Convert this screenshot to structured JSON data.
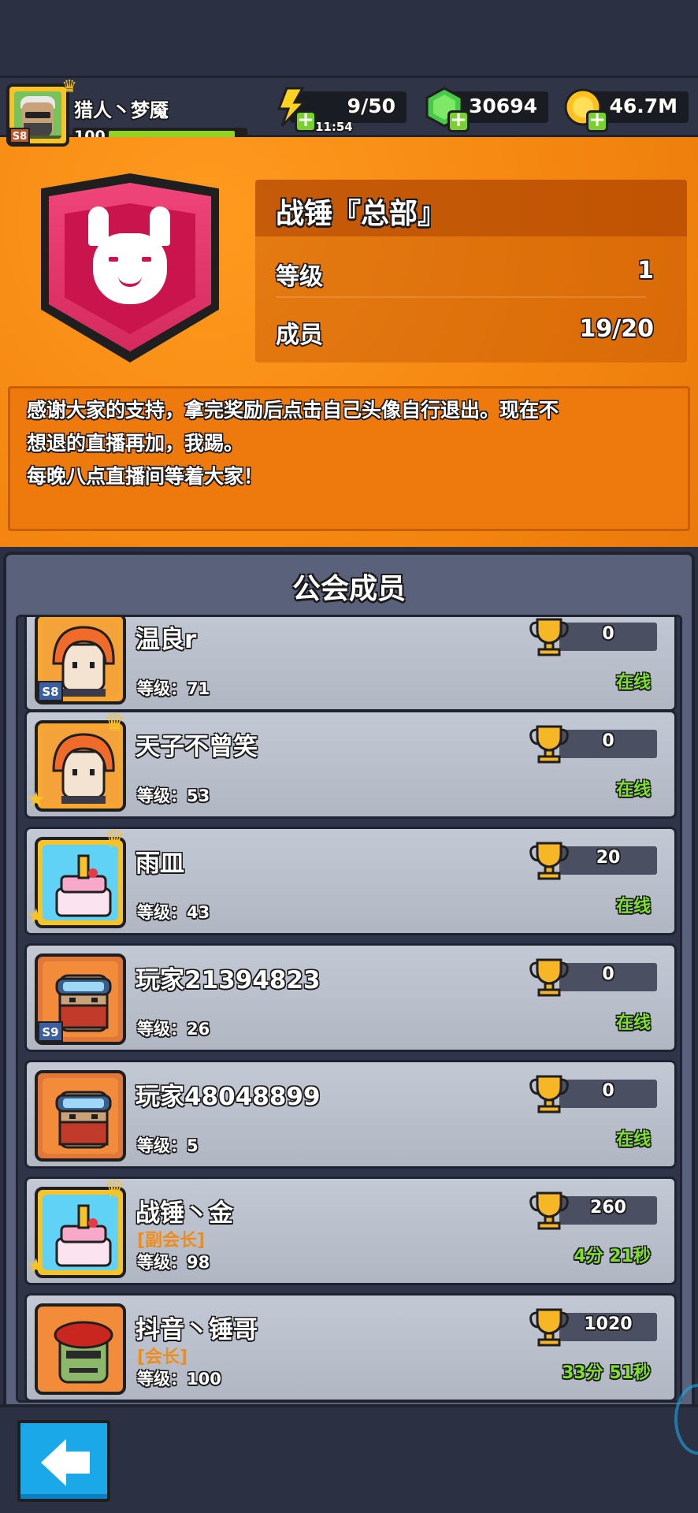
{
  "player": {
    "name": "猎人丶梦魇",
    "level": "100",
    "season": "S8",
    "level_fill": 0.95
  },
  "resources": {
    "energy": "9/50",
    "energy_timer": "11:54",
    "gems": "30694",
    "coins": "46.7M"
  },
  "guild": {
    "name": "战锤『总部』",
    "level_label": "等级",
    "level_value": "1",
    "members_label": "成员",
    "members_value": "19/20",
    "notice": "感谢大家的支持，拿完奖励后点击自己头像自行退出。现在不\n想退的直播再加，我踢。\n每晚八点直播间等着大家！"
  },
  "members_title": "公会成员",
  "members": [
    {
      "name": "温良r",
      "role": "",
      "level": "等级：71",
      "trophies": "0",
      "status": "在线",
      "season": "S8",
      "avatar": "red-hair"
    },
    {
      "name": "天子不曾笑",
      "role": "",
      "level": "等级：53",
      "trophies": "0",
      "status": "在线",
      "season": "",
      "avatar": "red-hair"
    },
    {
      "name": "雨皿",
      "role": "",
      "level": "等级：43",
      "trophies": "20",
      "status": "在线",
      "season": "",
      "avatar": "cake"
    },
    {
      "name": "玩家21394823",
      "role": "",
      "level": "等级：26",
      "trophies": "0",
      "status": "在线",
      "season": "S9",
      "avatar": "bandit"
    },
    {
      "name": "玩家48048899",
      "role": "",
      "level": "等级：5",
      "trophies": "0",
      "status": "在线",
      "season": "",
      "avatar": "bandit"
    },
    {
      "name": "战锤丶金",
      "role": "[副会长]",
      "level": "等级：98",
      "trophies": "260",
      "status": "4分 21秒",
      "season": "",
      "avatar": "cake"
    },
    {
      "name": "抖音丶锤哥",
      "role": "[会长]",
      "level": "等级：100",
      "trophies": "1020",
      "status": "33分 51秒",
      "season": "",
      "avatar": "zombie"
    }
  ],
  "icons": {
    "energy": "lightning-icon",
    "gems": "gem-icon",
    "coins": "coin-icon",
    "trophy": "trophy-icon",
    "back": "back-arrow-icon"
  },
  "colors": {
    "orange_bg": "#f58811",
    "online_green": "#7ee02e",
    "role_orange": "#f08c18",
    "back_blue": "#1aa8e8"
  }
}
